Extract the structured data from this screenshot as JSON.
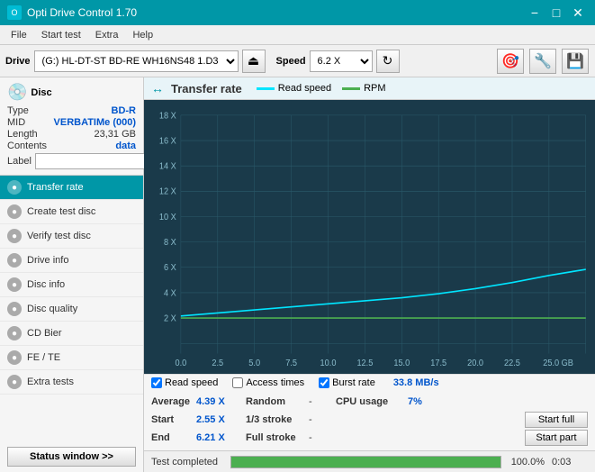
{
  "titlebar": {
    "title": "Opti Drive Control 1.70",
    "icon": "O",
    "minimize": "−",
    "maximize": "□",
    "close": "✕"
  },
  "menubar": {
    "items": [
      "File",
      "Start test",
      "Extra",
      "Help"
    ]
  },
  "toolbar": {
    "drive_label": "Drive",
    "drive_value": "(G:)  HL-DT-ST BD-RE  WH16NS48 1.D3",
    "eject_icon": "⏏",
    "speed_label": "Speed",
    "speed_value": "6.2 X",
    "refresh_icon": "↻",
    "icon1": "🎯",
    "icon2": "🔧",
    "icon3": "💾"
  },
  "disc": {
    "header_icon": "💿",
    "type_label": "Type",
    "type_value": "BD-R",
    "mid_label": "MID",
    "mid_value": "VERBATIMe (000)",
    "length_label": "Length",
    "length_value": "23,31 GB",
    "contents_label": "Contents",
    "contents_value": "data",
    "label_label": "Label",
    "label_placeholder": ""
  },
  "nav": {
    "items": [
      {
        "id": "transfer-rate",
        "label": "Transfer rate",
        "active": true
      },
      {
        "id": "create-test-disc",
        "label": "Create test disc",
        "active": false
      },
      {
        "id": "verify-test-disc",
        "label": "Verify test disc",
        "active": false
      },
      {
        "id": "drive-info",
        "label": "Drive info",
        "active": false
      },
      {
        "id": "disc-info",
        "label": "Disc info",
        "active": false
      },
      {
        "id": "disc-quality",
        "label": "Disc quality",
        "active": false
      },
      {
        "id": "cd-bier",
        "label": "CD Bier",
        "active": false
      },
      {
        "id": "fe-te",
        "label": "FE / TE",
        "active": false
      },
      {
        "id": "extra-tests",
        "label": "Extra tests",
        "active": false
      }
    ],
    "status_btn": "Status window >>"
  },
  "chart": {
    "title": "Transfer rate",
    "title_icon": "↔",
    "legend": [
      {
        "id": "read-speed",
        "label": "Read speed",
        "color": "#00e5ff"
      },
      {
        "id": "rpm",
        "label": "RPM",
        "color": "#4caf50"
      }
    ],
    "y_axis": [
      "18 X",
      "16 X",
      "14 X",
      "12 X",
      "10 X",
      "8 X",
      "6 X",
      "4 X",
      "2 X"
    ],
    "x_axis": [
      "0.0",
      "2.5",
      "5.0",
      "7.5",
      "10.0",
      "12.5",
      "15.0",
      "17.5",
      "20.0",
      "22.5",
      "25.0 GB"
    ]
  },
  "checkboxes": {
    "read_speed": {
      "label": "Read speed",
      "checked": true
    },
    "access_times": {
      "label": "Access times",
      "checked": false
    },
    "burst_rate": {
      "label": "Burst rate",
      "checked": true,
      "value": "33.8 MB/s"
    }
  },
  "stats": {
    "rows": [
      {
        "col1_label": "Average",
        "col1_value": "4.39 X",
        "col2_label": "Random",
        "col2_value": "-",
        "col3_label": "CPU usage",
        "col3_value": "7%",
        "action": null
      },
      {
        "col1_label": "Start",
        "col1_value": "2.55 X",
        "col2_label": "1/3 stroke",
        "col2_value": "-",
        "col3_label": "",
        "col3_value": "",
        "action": "Start full"
      },
      {
        "col1_label": "End",
        "col1_value": "6.21 X",
        "col2_label": "Full stroke",
        "col2_value": "-",
        "col3_label": "",
        "col3_value": "",
        "action": "Start part"
      }
    ]
  },
  "progress": {
    "status_text": "Test completed",
    "percentage": "100.0%",
    "fill_width": "100%",
    "time": "0:03"
  }
}
